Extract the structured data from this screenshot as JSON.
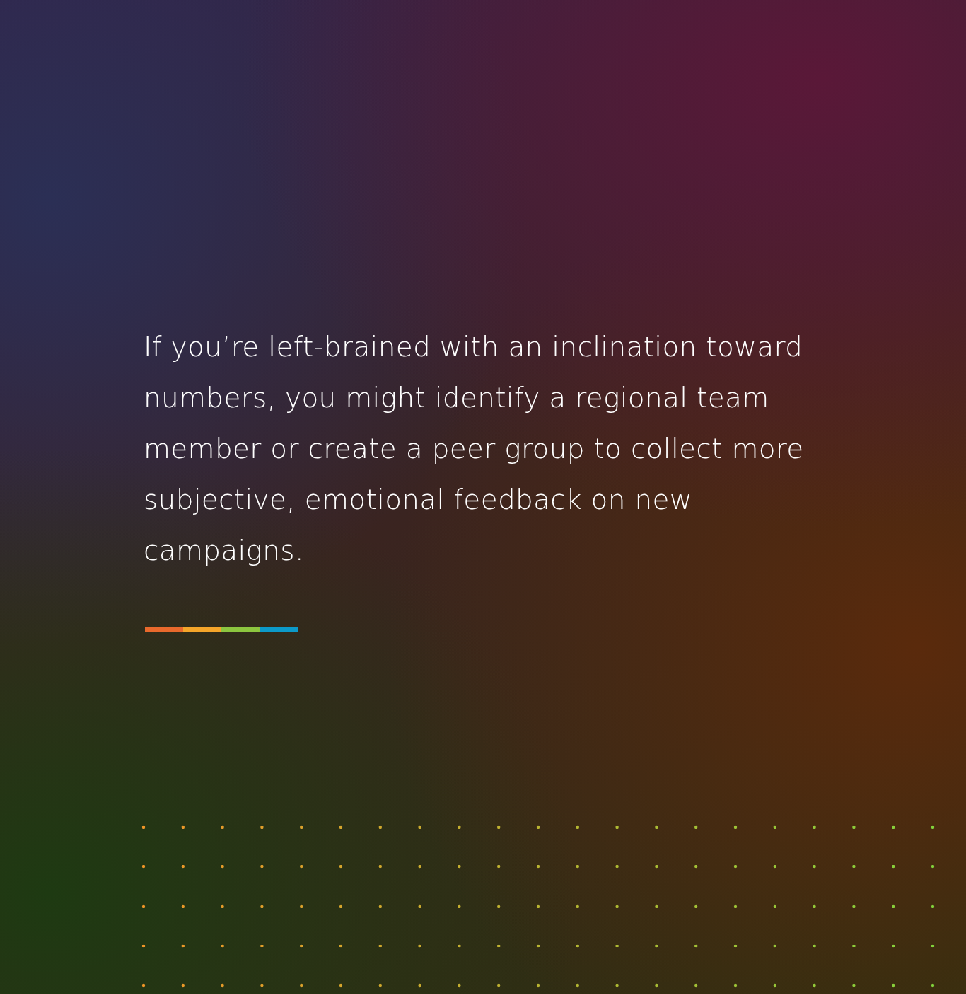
{
  "quote": {
    "text": "If you’re left-brained with an inclination toward numbers, you might identify a regional team member or create a peer group to collect more subjective, emotional feedback on new campaigns."
  },
  "accent_bar": {
    "segments": [
      {
        "color": "#e8692c"
      },
      {
        "color": "#f4a52a"
      },
      {
        "color": "#8cc63f"
      },
      {
        "color": "#0c9ac9"
      }
    ]
  }
}
